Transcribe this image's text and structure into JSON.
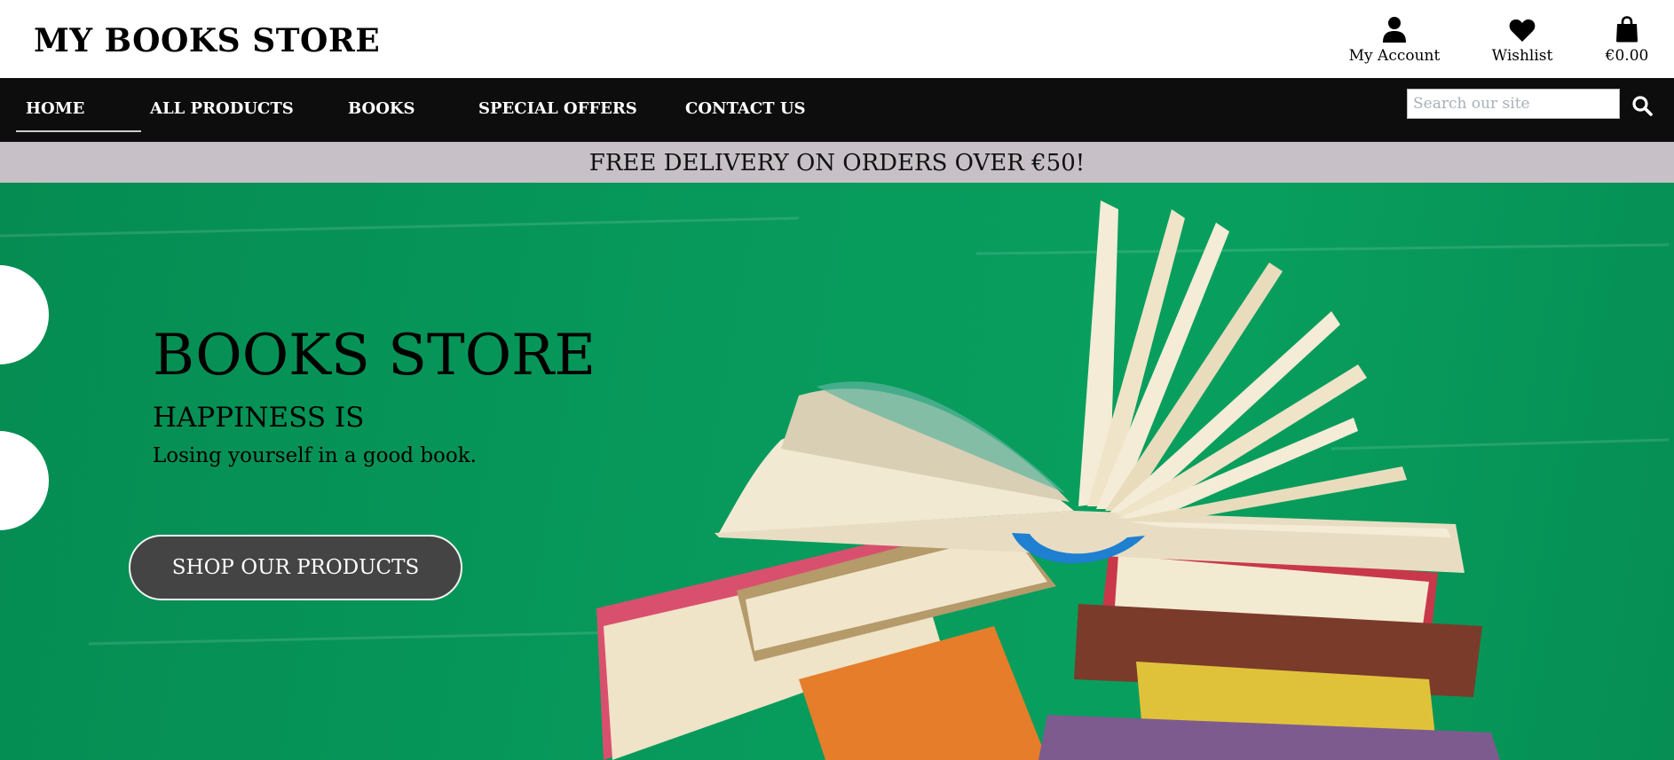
{
  "header": {
    "brand": "MY BOOKS STORE",
    "account_label": "My Account",
    "wishlist_label": "Wishlist",
    "bag_total": "€0.00"
  },
  "nav": {
    "items": [
      {
        "label": "HOME",
        "active": true
      },
      {
        "label": "ALL PRODUCTS"
      },
      {
        "label": "BOOKS"
      },
      {
        "label": "SPECIAL OFFERS"
      },
      {
        "label": "CONTACT US"
      }
    ],
    "search_placeholder": "Search our site"
  },
  "promo": {
    "text": "FREE DELIVERY ON ORDERS OVER €50!"
  },
  "hero": {
    "title": "BOOKS STORE",
    "subtitle": "HAPPINESS IS",
    "tagline": "Losing yourself in a good book.",
    "cta_label": "SHOP OUR PRODUCTS"
  },
  "icons": [
    "user-icon",
    "heart-icon",
    "shopping-bag-icon",
    "search-icon"
  ],
  "colors": {
    "nav_bg": "#0d0d0d",
    "promo_bg": "#c7c1c7",
    "hero_bg": "#079a5c",
    "cta_bg": "#444444"
  }
}
